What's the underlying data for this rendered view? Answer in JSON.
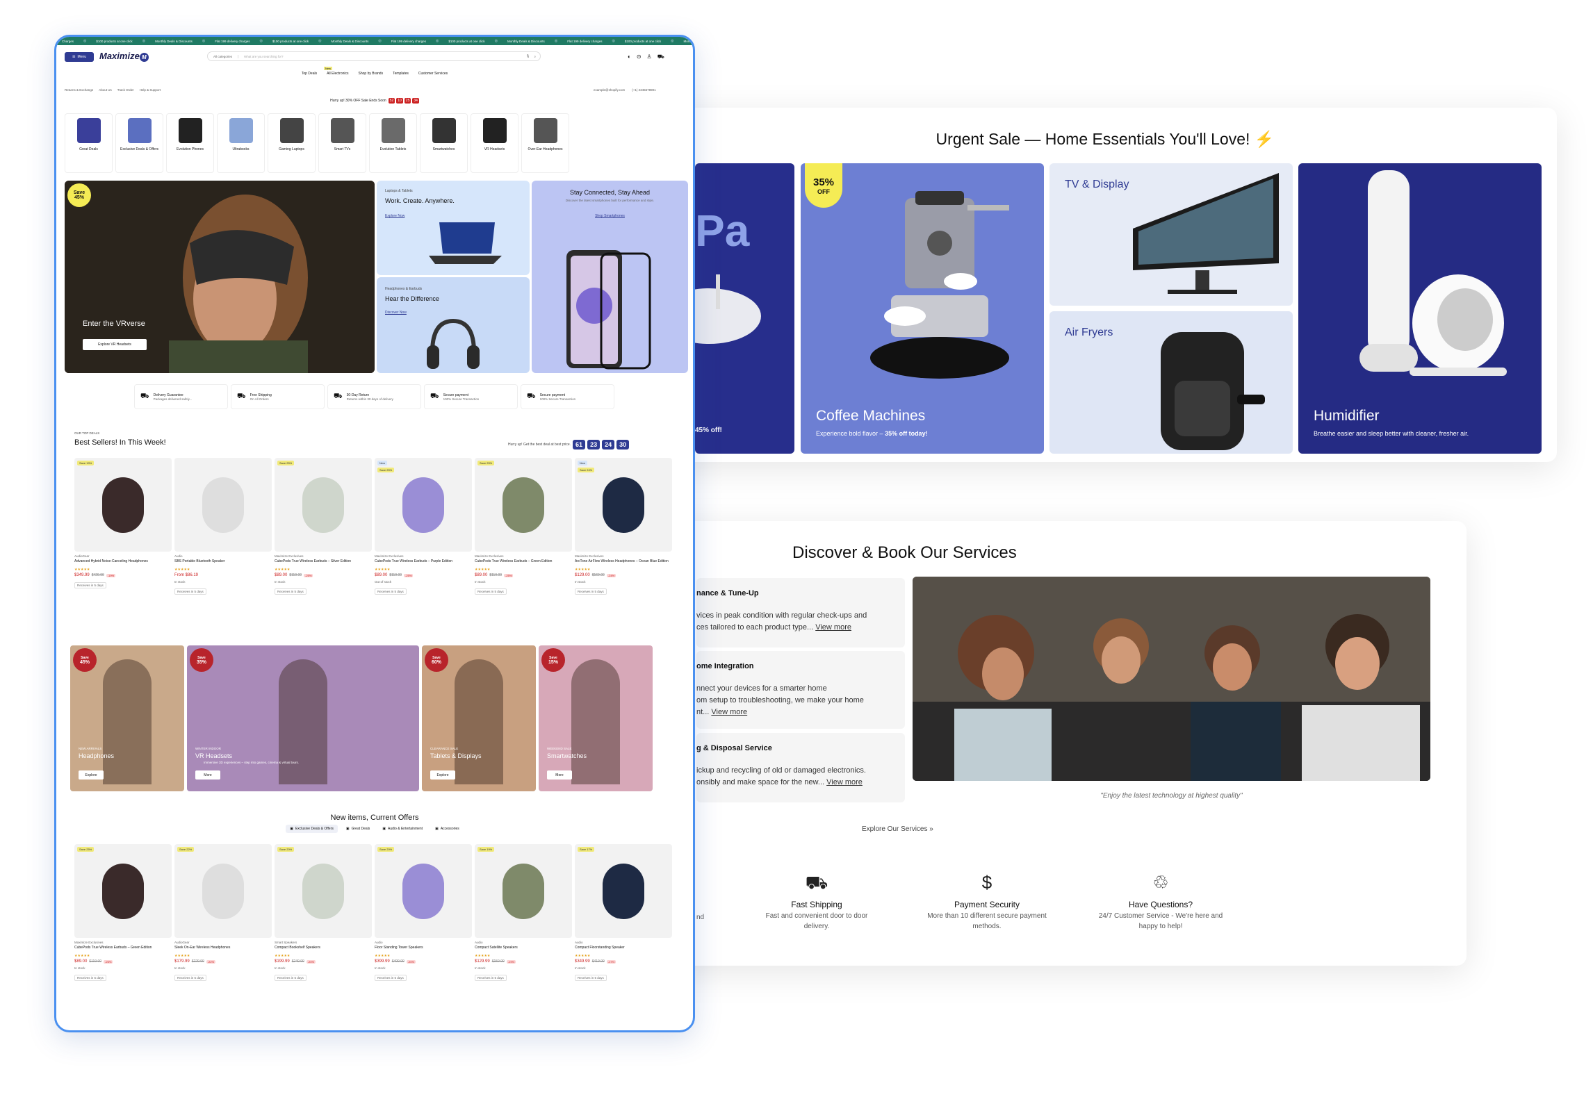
{
  "sale": {
    "title": "Urgent Sale — Home Essentials You'll Love!",
    "partial_big": "Pa",
    "partial_off": "45% off!",
    "coffee": {
      "badge_pct": "35%",
      "badge_off": "OFF",
      "title": "Coffee Machines",
      "sub_a": "Experience bold flavor – ",
      "sub_b": "35% off today!"
    },
    "tv_label": "TV & Display",
    "fryer_label": "Air Fryers",
    "humid": {
      "title": "Humidifier",
      "sub": "Breathe easier and sleep better with cleaner, fresher air."
    }
  },
  "services": {
    "title": "Discover & Book Our Services",
    "items": [
      {
        "title": "nance & Tune-Up",
        "line1": "vices in peak condition with regular check-ups and",
        "line2": "ces tailored to each product type...",
        "link": "View more"
      },
      {
        "title": "ome Integration",
        "line1": "nnect your devices for a smarter home",
        "line2": "om setup to troubleshooting, we make your home",
        "line3": "nt...",
        "link": "View more"
      },
      {
        "title": "g & Disposal Service",
        "line1": "ickup and recycling of old or damaged electronics.",
        "line2": "onsibly and make space for the new...",
        "link": "View more"
      }
    ],
    "caption": "\"Enjoy the latest technology at highest quality\"",
    "explore": "Explore Our Services",
    "explore_arrow": "»",
    "feat_partial": "nd",
    "features": [
      {
        "title": "Fast Shipping",
        "line1": "Fast and convenient door to door",
        "line2": "delivery."
      },
      {
        "title": "Payment Security",
        "line1": "More than 10 different secure payment",
        "line2": "methods."
      },
      {
        "title": "Have Questions?",
        "line1": "24/7 Customer Service - We're here and",
        "line2": "happy to help!"
      }
    ]
  },
  "shop": {
    "ticker": [
      "Charges",
      "$100 products at one click",
      "Monthly Deals & Discounts",
      "Flat 199 delivery charges",
      "$100 products at one click",
      "Monthly Deals & Discounts",
      "Flat 199 delivery charges",
      "$100 products at one click",
      "Monthly Deals & Discounts",
      "Flat 199 delivery charges",
      "$100 products at one click",
      "Monthly Deals"
    ],
    "menu_label": "Menu",
    "logo": "Maximize",
    "logo_mark": "M",
    "category_select": "All categories",
    "search_placeholder": "What are you searching for?",
    "nav": [
      "Top Deals",
      "All Electronics",
      "Shop by Brands",
      "Templates",
      "Customer Services"
    ],
    "nav_new": "New",
    "util_links": [
      "Returns & Exchange",
      "About Us",
      "Track Order",
      "Help & Support"
    ],
    "email": "example@shopify.com",
    "phone": "(+1) 2345678901",
    "promo": "Hurry up! 30% OFF Sale Ends Soon",
    "promo_timer": [
      "52",
      "10",
      "25",
      "34"
    ],
    "categories": [
      "Great Deals",
      "Exclusive Deals & Offers",
      "Evolution Phones",
      "Ultrabooks",
      "Gaming Laptops",
      "Smart TVs",
      "Evolution Tablets",
      "Smartwatches",
      "VR Headsets",
      "Over-Ear Headphones"
    ],
    "hero": {
      "badge_top": "Save",
      "badge_pct": "45%",
      "title": "Enter the VRverse",
      "btn": "Explore VR Headsets"
    },
    "laptops": {
      "eyebrow": "Laptops & Tablets",
      "title": "Work. Create. Anywhere.",
      "link": "Explore Now"
    },
    "phones": {
      "title": "Stay Connected, Stay Ahead",
      "sub": "Discover the latest smartphones built for performance and style.",
      "link": "Shop Smartphones"
    },
    "headphones": {
      "eyebrow": "Headphones & Earbuds",
      "title": "Hear the Difference",
      "link": "Discover Now"
    },
    "perks": [
      {
        "title": "Delivery Guarantee",
        "sub": "Packages delivered safely..."
      },
      {
        "title": "Free Shipping",
        "sub": "On All Orders"
      },
      {
        "title": "30-Day Return",
        "sub": "Returns within 30 days of delivery"
      },
      {
        "title": "Secure payment",
        "sub": "100% Secure Transaction"
      },
      {
        "title": "Secure payment",
        "sub": "100% Secure Transaction"
      }
    ],
    "best": {
      "eyebrow": "OUR TOP DEALS",
      "title": "Best Sellers! In This Week!",
      "hurry": "Hurry up! Get the best deal at best price.",
      "timer": [
        "61",
        "23",
        "24",
        "30"
      ]
    },
    "products": [
      {
        "badge": "Save 19%",
        "brand": "AudioGear",
        "name": "Advanced Hybrid Noise-Canceling Headphones",
        "price": "$349.99",
        "old": "$429.99",
        "off": "-19%",
        "stock": "",
        "delivery": "Receives in 5 days"
      },
      {
        "badge": "",
        "brand": "Audio",
        "name": "SBS Portable Bluetooth Speaker",
        "price": "From $86.19",
        "old": "",
        "off": "",
        "stock": "In stock",
        "delivery": "Receives in 5 days"
      },
      {
        "badge": "Save 25%",
        "brand": "Maximize Exclusives",
        "name": "CubePods True Wireless Earbuds – Silver Edition",
        "price": "$89.00",
        "old": "$119.00",
        "off": "-25%",
        "stock": "In stock",
        "delivery": "Receives in 5 days"
      },
      {
        "badge": "Save 25%",
        "brand": "Maximize Exclusives",
        "name": "CubePods True Wireless Earbuds – Purple Edition",
        "price": "$89.00",
        "old": "$119.00",
        "off": "-25%",
        "stock": "Out of stock",
        "delivery": "Receives in 5 days"
      },
      {
        "badge": "Save 25%",
        "brand": "Maximize Exclusives",
        "name": "CubePods True Wireless Earbuds – Green Edition",
        "price": "$89.00",
        "old": "$119.00",
        "off": "-25%",
        "stock": "In stock",
        "delivery": "Receives in 5 days"
      },
      {
        "badge": "Save 24%",
        "brand": "Maximize Exclusives",
        "name": "ArcTone AirFlow Wireless Headphones – Ocean Blue Edition",
        "price": "$129.00",
        "old": "$169.00",
        "off": "-24%",
        "stock": "In stock",
        "delivery": "Receives in 5 days"
      }
    ],
    "product_new": "New",
    "banners": [
      {
        "badge_pct": "45%",
        "eyebrow": "NEW ARRIVALS",
        "title": "Headphones",
        "sub": "",
        "btn": "Explore"
      },
      {
        "badge_pct": "35%",
        "eyebrow": "WINTER INDOOR",
        "title": "VR Headsets",
        "sub": "Immersive 3D experiences – step into games, cinema & virtual tours.",
        "btn": "More"
      },
      {
        "badge_pct": "60%",
        "eyebrow": "CLEARANCE SALE",
        "title": "Tablets & Displays",
        "sub": "",
        "btn": "Explore"
      },
      {
        "badge_pct": "15%",
        "eyebrow": "WEEKEND SALE",
        "title": "Smartwatches",
        "sub": "",
        "btn": "More"
      }
    ],
    "banner_save": "Save",
    "newitems": {
      "title": "New items, Current Offers",
      "tabs": [
        "Exclusive Deals & Offers",
        "Great Deals",
        "Audio & Entertainment",
        "Accessories"
      ]
    },
    "products2": [
      {
        "badge": "Save 25%",
        "brand": "Maximize Exclusives",
        "name": "CubePods True Wireless Earbuds – Green Edition",
        "price": "$89.00",
        "old": "$119.00",
        "off": "-25%",
        "stock": "In stock",
        "delivery": "Receives in 5 days"
      },
      {
        "badge": "Save 22%",
        "brand": "AudioGear",
        "name": "Sleek On-Ear Wireless Headphones",
        "price": "$179.99",
        "old": "$229.99",
        "off": "-22%",
        "stock": "In stock",
        "delivery": "Receives in 5 days"
      },
      {
        "badge": "Save 20%",
        "brand": "Smart Speakers",
        "name": "Compact Bookshelf Speakers",
        "price": "$199.99",
        "old": "$249.99",
        "off": "-20%",
        "stock": "In stock",
        "delivery": "Receives in 5 days"
      },
      {
        "badge": "Save 20%",
        "brand": "Audio",
        "name": "Floor Standing Tower Speakers",
        "price": "$399.99",
        "old": "$499.99",
        "off": "-20%",
        "stock": "In stock",
        "delivery": "Receives in 5 days"
      },
      {
        "badge": "Save 19%",
        "brand": "Audio",
        "name": "Compact Satellite Speakers",
        "price": "$129.99",
        "old": "$159.99",
        "off": "-19%",
        "stock": "In stock",
        "delivery": "Receives in 5 days"
      },
      {
        "badge": "Save 17%",
        "brand": "Audio",
        "name": "Compact Floorstanding Speaker",
        "price": "$349.99",
        "old": "$419.99",
        "off": "-17%",
        "stock": "In stock",
        "delivery": "Receives in 5 days"
      }
    ]
  },
  "colors": {
    "navy": "#2c2f8f",
    "accent_blue": "#4a90f0",
    "yellow": "#f5ec55",
    "red": "#b8242b",
    "orange": "#f08a24"
  }
}
